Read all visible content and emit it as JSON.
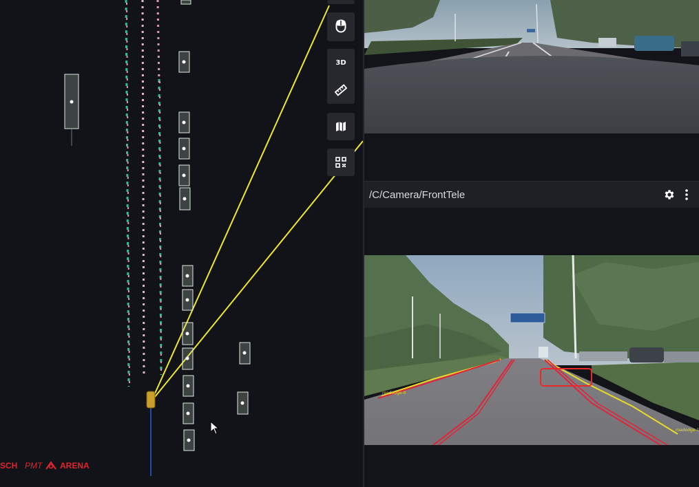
{
  "toolbar": {
    "items": [
      {
        "icon": "mouse-icon"
      },
      {
        "icon": "3d-icon",
        "label": "3D"
      },
      {
        "icon": "ruler-icon"
      },
      {
        "icon": "map-icon"
      },
      {
        "icon": "qr-code-icon"
      }
    ]
  },
  "camera_panel": {
    "title": "/C/Camera/FrontTele",
    "settings_icon": "gear-icon",
    "menu_icon": "more-vertical-icon"
  },
  "overlay_labels": {
    "left_roadedge": "roadedge-0",
    "right_roadedge": "roadedge-1"
  },
  "branding": {
    "logo1": "SCH",
    "logo2": "PMT",
    "logo3": "ARENA"
  },
  "colors": {
    "background": "#121318",
    "toolbar": "#27282e",
    "fov_line": "#f0e82a",
    "lane_line": "#e0243a",
    "road_edge": "#e8d92a",
    "brand": "#e0242d",
    "vehicle_box": "#dfe8de"
  }
}
